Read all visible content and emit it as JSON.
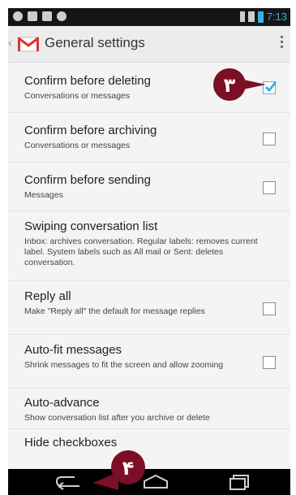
{
  "status_bar": {
    "time": "7:13"
  },
  "action_bar": {
    "title": "General settings"
  },
  "settings": [
    {
      "title": "Confirm before deleting",
      "summary": "Conversations or messages",
      "checkbox": true,
      "checked": true
    },
    {
      "title": "Confirm before archiving",
      "summary": "Conversations or messages",
      "checkbox": true,
      "checked": false
    },
    {
      "title": "Confirm before sending",
      "summary": "Messages",
      "checkbox": true,
      "checked": false
    },
    {
      "title": "Swiping conversation list",
      "summary": "Inbox: archives conversation. Regular labels: removes current label. System labels such as All mail or Sent: deletes conversation.",
      "checkbox": false
    },
    {
      "title": "Reply all",
      "summary": "Make \"Reply all\" the default for message replies",
      "checkbox": true,
      "checked": false
    },
    {
      "title": "Auto-fit messages",
      "summary": "Shrink messages to fit the screen and allow zooming",
      "checkbox": true,
      "checked": false
    },
    {
      "title": "Auto-advance",
      "summary": "Show conversation list after you archive or delete",
      "checkbox": false
    },
    {
      "title": "Hide checkboxes",
      "summary": "",
      "checkbox": false
    }
  ],
  "annotations": {
    "marker_3": "٣",
    "marker_4": "۴"
  },
  "colors": {
    "marker": "#7a0f26",
    "accent": "#39b2e6",
    "gmail_red": "#d33"
  }
}
